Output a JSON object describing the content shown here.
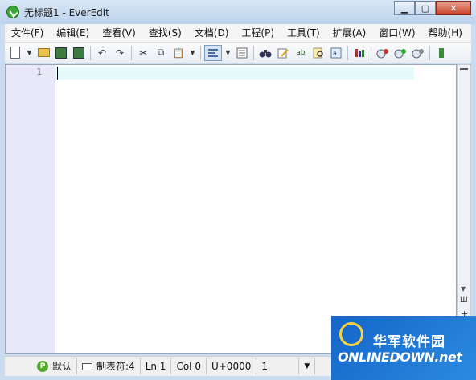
{
  "window": {
    "title": "无标题1 - EverEdit",
    "controls": {
      "minimize": "▁",
      "maximize": "▢",
      "close": "✕"
    }
  },
  "menu": {
    "items": [
      "文件(F)",
      "编辑(E)",
      "查看(V)",
      "查找(S)",
      "文档(D)",
      "工程(P)",
      "工具(T)",
      "扩展(A)",
      "窗口(W)",
      "帮助(H)"
    ]
  },
  "toolbar": {
    "glyphs": {
      "undo": "↶",
      "redo": "↷",
      "cut": "✂",
      "copy": "⧉",
      "paste": "📋",
      "find": "🔍",
      "replace": "ab",
      "dropdown": "▼"
    }
  },
  "editor": {
    "line_numbers": [
      "1"
    ],
    "content": ""
  },
  "scrollbar": {
    "down_arrow": "▼",
    "split": "Ш",
    "plus": "+"
  },
  "status": {
    "encoding_badge": "P",
    "scheme": "默认",
    "tab": "制表符:4",
    "line": "Ln 1",
    "col": "Col 0",
    "unicode": "U+0000",
    "selection": "1",
    "dropdown": "▼"
  },
  "watermark": {
    "cn": "华军软件园",
    "en": "ONLINEDOWN.net"
  },
  "colors": {
    "gutter": "#e8e8f8",
    "current_line": "#e6fafc",
    "title_gradient_top": "#d8e7f6",
    "watermark_blue": "#1565c8"
  }
}
